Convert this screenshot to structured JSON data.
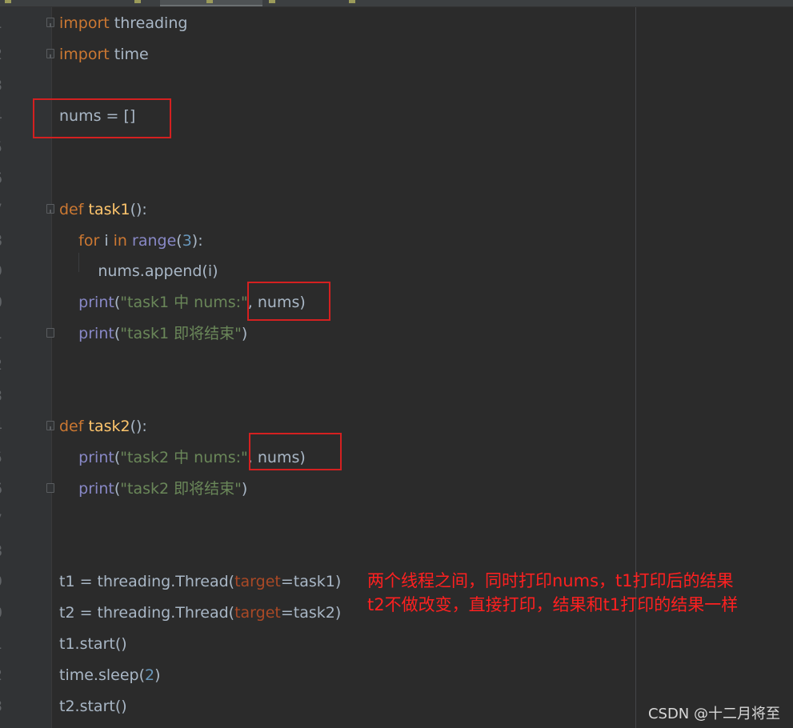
{
  "editor": {
    "lines": [
      {
        "no": "1",
        "parts": [
          [
            "kw",
            "import"
          ],
          [
            "txt",
            " threading"
          ]
        ]
      },
      {
        "no": "2",
        "parts": [
          [
            "kw",
            "import"
          ],
          [
            "txt",
            " time"
          ]
        ]
      },
      {
        "no": "3",
        "parts": []
      },
      {
        "no": "4",
        "parts": [
          [
            "txt",
            "nums = []"
          ]
        ]
      },
      {
        "no": "5",
        "parts": []
      },
      {
        "no": "6",
        "parts": []
      },
      {
        "no": "7",
        "parts": [
          [
            "kw",
            "def"
          ],
          [
            "txt",
            " "
          ],
          [
            "fn",
            "task1"
          ],
          [
            "txt",
            "():"
          ]
        ]
      },
      {
        "no": "8",
        "parts": [
          [
            "txt",
            "    "
          ],
          [
            "kw",
            "for"
          ],
          [
            "txt",
            " i "
          ],
          [
            "kw",
            "in"
          ],
          [
            "txt",
            " "
          ],
          [
            "bi",
            "range"
          ],
          [
            "txt",
            "("
          ],
          [
            "num",
            "3"
          ],
          [
            "txt",
            "):"
          ]
        ]
      },
      {
        "no": "9",
        "parts": [
          [
            "txt",
            "        nums.append(i)"
          ]
        ]
      },
      {
        "no": "0",
        "parts": [
          [
            "txt",
            "    "
          ],
          [
            "bi",
            "print"
          ],
          [
            "txt",
            "("
          ],
          [
            "str",
            "\"task1 中 nums:\""
          ],
          [
            "txt",
            ", nums)"
          ]
        ]
      },
      {
        "no": "1",
        "parts": [
          [
            "txt",
            "    "
          ],
          [
            "bi",
            "print"
          ],
          [
            "txt",
            "("
          ],
          [
            "str",
            "\"task1 即将结束\""
          ],
          [
            "txt",
            ")"
          ]
        ]
      },
      {
        "no": "2",
        "parts": []
      },
      {
        "no": "3",
        "parts": []
      },
      {
        "no": "4",
        "parts": [
          [
            "kw",
            "def"
          ],
          [
            "txt",
            " "
          ],
          [
            "fn",
            "task2"
          ],
          [
            "txt",
            "():"
          ]
        ]
      },
      {
        "no": "5",
        "parts": [
          [
            "txt",
            "    "
          ],
          [
            "bi",
            "print"
          ],
          [
            "txt",
            "("
          ],
          [
            "str",
            "\"task2 中 nums:\""
          ],
          [
            "txt",
            ", nums)"
          ]
        ]
      },
      {
        "no": "6",
        "parts": [
          [
            "txt",
            "    "
          ],
          [
            "bi",
            "print"
          ],
          [
            "txt",
            "("
          ],
          [
            "str",
            "\"task2 即将结束\""
          ],
          [
            "txt",
            ")"
          ]
        ]
      },
      {
        "no": "7",
        "parts": []
      },
      {
        "no": "8",
        "parts": []
      },
      {
        "no": "9",
        "parts": [
          [
            "txt",
            "t1 = threading.Thread("
          ],
          [
            "par",
            "target"
          ],
          [
            "txt",
            "=task1)"
          ]
        ]
      },
      {
        "no": "0",
        "parts": [
          [
            "txt",
            "t2 = threading.Thread("
          ],
          [
            "par",
            "target"
          ],
          [
            "txt",
            "=task2)"
          ]
        ]
      },
      {
        "no": "1",
        "parts": [
          [
            "txt",
            "t1.start()"
          ]
        ]
      },
      {
        "no": "2",
        "parts": [
          [
            "txt",
            "time.sleep("
          ],
          [
            "num",
            "2"
          ],
          [
            "txt",
            ")"
          ]
        ]
      },
      {
        "no": "3",
        "parts": [
          [
            "txt",
            "t2.start()"
          ]
        ]
      }
    ]
  },
  "annotation": {
    "line1": "两个线程之间，同时打印nums，t1打印后的结果",
    "line2": "t2不做改变，直接打印，结果和t1打印的结果一样"
  },
  "watermark": "CSDN @十二月将至",
  "colors": {
    "keyword": "#cc7832",
    "function": "#ffc66d",
    "builtin": "#8888c6",
    "number": "#6897bb",
    "string": "#6a8759",
    "param": "#aa4926",
    "text": "#a9b7c6",
    "highlight_box": "#d42020",
    "annotation": "#ff2020"
  }
}
